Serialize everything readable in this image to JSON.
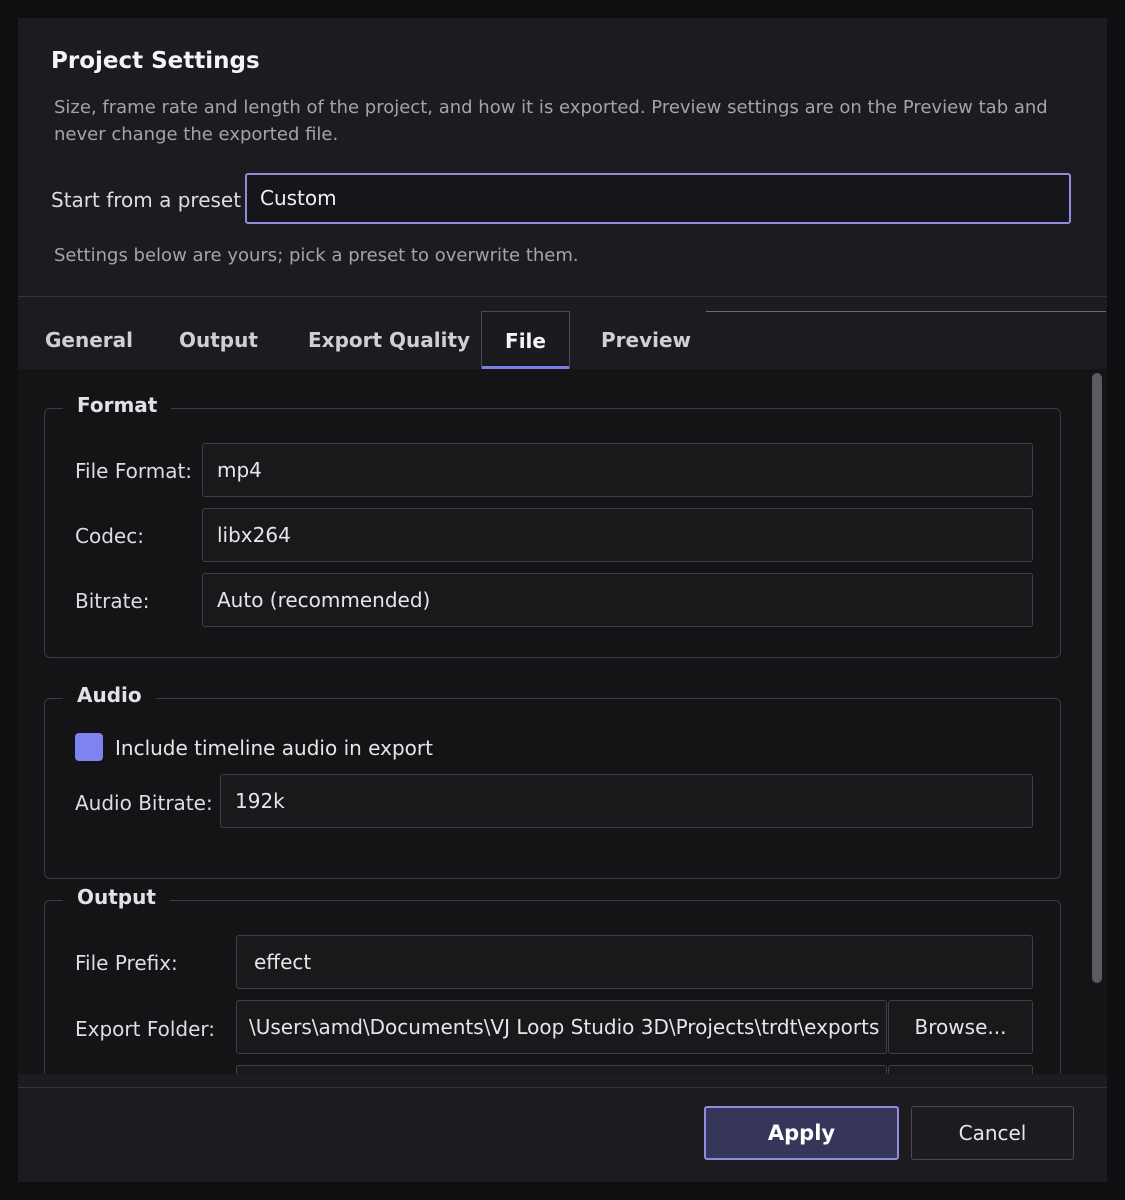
{
  "dialog": {
    "title": "Project Settings",
    "description": "Size, frame rate and length of the project, and how it is exported. Preview settings are on the Preview tab and never change the exported file.",
    "preset": {
      "label": "Start from a preset",
      "value": "Custom",
      "hint": "Settings below are yours; pick a preset to overwrite them."
    }
  },
  "tabs": [
    {
      "label": "General",
      "active": false
    },
    {
      "label": "Output",
      "active": false
    },
    {
      "label": "Export Quality",
      "active": false
    },
    {
      "label": "File",
      "active": true
    },
    {
      "label": "Preview",
      "active": false
    }
  ],
  "format_group": {
    "title": "Format",
    "file_format": {
      "label": "File Format:",
      "value": "mp4"
    },
    "codec": {
      "label": "Codec:",
      "value": "libx264"
    },
    "bitrate": {
      "label": "Bitrate:",
      "value": "Auto (recommended)"
    }
  },
  "audio_group": {
    "title": "Audio",
    "include_audio": {
      "label": "Include timeline audio in export",
      "checked": true
    },
    "audio_bitrate": {
      "label": "Audio Bitrate:",
      "value": "192k"
    }
  },
  "output_group": {
    "title": "Output",
    "file_prefix": {
      "label": "File Prefix:",
      "value": "effect"
    },
    "export_folder": {
      "label": "Export Folder:",
      "value": "\\Users\\amd\\Documents\\VJ Loop Studio 3D\\Projects\\trdt\\exports",
      "browse_label": "Browse..."
    }
  },
  "footer": {
    "apply_label": "Apply",
    "cancel_label": "Cancel"
  },
  "colors": {
    "accent": "#7d83f0",
    "background": "#1c1c20",
    "content_background": "#141417"
  }
}
